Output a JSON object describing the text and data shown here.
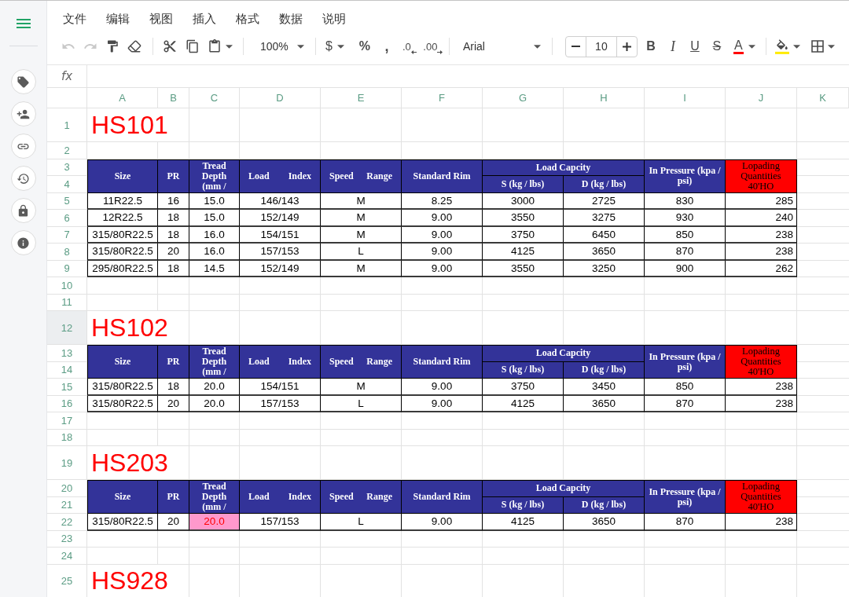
{
  "menu": [
    "文件",
    "编辑",
    "视图",
    "插入",
    "格式",
    "数据",
    "说明"
  ],
  "toolbar": {
    "undo": {
      "disabled": true
    },
    "redo": {
      "disabled": true
    },
    "zoom": "100%",
    "number_formats": [
      {
        "kind": "currency",
        "label": "$"
      },
      {
        "kind": "percent",
        "label": "%"
      },
      {
        "kind": "comma",
        "label": ","
      },
      {
        "kind": "decrease_decimal",
        "label": ".0"
      },
      {
        "kind": "increase_decimal",
        "label": ".00"
      }
    ],
    "font": "Arial",
    "font_size": "10",
    "text_styles": [
      {
        "kind": "bold",
        "label": "B"
      },
      {
        "kind": "italic",
        "label": "I"
      },
      {
        "kind": "underline",
        "label": "U"
      },
      {
        "kind": "strikethrough",
        "label": "S"
      },
      {
        "kind": "text_color",
        "label": "A"
      }
    ]
  },
  "formula_bar": {
    "label": "fx"
  },
  "sheet": {
    "columns": [
      "A",
      "B",
      "C",
      "D",
      "E",
      "F",
      "G",
      "H",
      "I",
      "J",
      "K"
    ],
    "rows": [
      {
        "number": "1",
        "selected": false,
        "kind": "title",
        "title": "HS101"
      },
      {
        "number": "2",
        "selected": false,
        "kind": "blank"
      },
      {
        "number": "3",
        "selected": false,
        "kind": "header",
        "headers": [
          {
            "kind": "column",
            "label": "Size"
          },
          {
            "kind": "column",
            "label": "PR"
          },
          {
            "kind": "column",
            "label": "Tread Depth (mm /"
          },
          {
            "kind": "spread",
            "label": "Load Index"
          },
          {
            "kind": "spread",
            "label": "Speed Range"
          },
          {
            "kind": "column",
            "label": "Standard Rim"
          },
          {
            "kind": "group",
            "label": "Load Capcity",
            "children": [
              "S (kg / lbs)",
              "D (kg / lbs)"
            ]
          },
          {
            "kind": "column",
            "label": "In Pressure (kpa / psi)"
          },
          {
            "kind": "flagged",
            "label": "Lopading Quantities 40'HO"
          }
        ]
      },
      {
        "number": "4",
        "selected": false,
        "kind": "header_cont"
      },
      {
        "number": "5",
        "selected": false,
        "kind": "data",
        "tread_highlighted": false,
        "cells": [
          "11R22.5",
          "16",
          "15.0",
          "146/143",
          "M",
          "8.25",
          "3000",
          "2725",
          "830",
          "285"
        ]
      },
      {
        "number": "6",
        "selected": false,
        "kind": "data",
        "tread_highlighted": false,
        "cells": [
          "12R22.5",
          "18",
          "15.0",
          "152/149",
          "M",
          "9.00",
          "3550",
          "3275",
          "930",
          "240"
        ]
      },
      {
        "number": "7",
        "selected": false,
        "kind": "data",
        "tread_highlighted": false,
        "cells": [
          "315/80R22.5",
          "18",
          "16.0",
          "154/151",
          "M",
          "9.00",
          "3750",
          "6450",
          "850",
          "238"
        ]
      },
      {
        "number": "8",
        "selected": false,
        "kind": "data",
        "tread_highlighted": false,
        "cells": [
          "315/80R22.5",
          "20",
          "16.0",
          "157/153",
          "L",
          "9.00",
          "4125",
          "3650",
          "870",
          "238"
        ]
      },
      {
        "number": "9",
        "selected": false,
        "kind": "data",
        "tread_highlighted": false,
        "cells": [
          "295/80R22.5",
          "18",
          "14.5",
          "152/149",
          "M",
          "9.00",
          "3550",
          "3250",
          "900",
          "262"
        ]
      },
      {
        "number": "10",
        "selected": false,
        "kind": "blank"
      },
      {
        "number": "11",
        "selected": false,
        "kind": "blank"
      },
      {
        "number": "12",
        "selected": true,
        "kind": "title",
        "title": "HS102"
      },
      {
        "number": "13",
        "selected": false,
        "kind": "header",
        "headers": [
          {
            "kind": "column",
            "label": "Size"
          },
          {
            "kind": "column",
            "label": "PR"
          },
          {
            "kind": "column",
            "label": "Tread Depth (mm /"
          },
          {
            "kind": "spread",
            "label": "Load Index"
          },
          {
            "kind": "spread",
            "label": "Speed Range"
          },
          {
            "kind": "column",
            "label": "Standard Rim"
          },
          {
            "kind": "group",
            "label": "Load Capcity",
            "children": [
              "S (kg / lbs)",
              "D (kg / lbs)"
            ]
          },
          {
            "kind": "column",
            "label": "In Pressure (kpa / psi)"
          },
          {
            "kind": "flagged",
            "label": "Lopading Quantities 40'HO"
          }
        ]
      },
      {
        "number": "14",
        "selected": false,
        "kind": "header_cont"
      },
      {
        "number": "15",
        "selected": false,
        "kind": "data",
        "tread_highlighted": false,
        "cells": [
          "315/80R22.5",
          "18",
          "20.0",
          "154/151",
          "M",
          "9.00",
          "3750",
          "3450",
          "850",
          "238"
        ]
      },
      {
        "number": "16",
        "selected": false,
        "kind": "data",
        "tread_highlighted": false,
        "cells": [
          "315/80R22.5",
          "20",
          "20.0",
          "157/153",
          "L",
          "9.00",
          "4125",
          "3650",
          "870",
          "238"
        ]
      },
      {
        "number": "17",
        "selected": false,
        "kind": "blank"
      },
      {
        "number": "18",
        "selected": false,
        "kind": "blank"
      },
      {
        "number": "19",
        "selected": false,
        "kind": "title",
        "title": "HS203"
      },
      {
        "number": "20",
        "selected": false,
        "kind": "header",
        "headers": [
          {
            "kind": "column",
            "label": "Size"
          },
          {
            "kind": "column",
            "label": "PR"
          },
          {
            "kind": "column",
            "label": "Tread Depth (mm /"
          },
          {
            "kind": "spread",
            "label": "Load Index"
          },
          {
            "kind": "spread",
            "label": "Speed Range"
          },
          {
            "kind": "column",
            "label": "Standard Rim"
          },
          {
            "kind": "group",
            "label": "Load Capcity",
            "children": [
              "S (kg / lbs)",
              "D (kg / lbs)"
            ]
          },
          {
            "kind": "column",
            "label": "In Pressure (kpa / psi)"
          },
          {
            "kind": "flagged",
            "label": "Lopading Quantities 40'HO"
          }
        ]
      },
      {
        "number": "21",
        "selected": false,
        "kind": "header_cont"
      },
      {
        "number": "22",
        "selected": false,
        "kind": "data",
        "tread_highlighted": true,
        "cells": [
          "315/80R22.5",
          "20",
          "20.0",
          "157/153",
          "L",
          "9.00",
          "4125",
          "3650",
          "870",
          "238"
        ]
      },
      {
        "number": "23",
        "selected": false,
        "kind": "blank"
      },
      {
        "number": "24",
        "selected": false,
        "kind": "blank"
      },
      {
        "number": "25",
        "selected": false,
        "kind": "title",
        "title": "HS928"
      }
    ]
  }
}
